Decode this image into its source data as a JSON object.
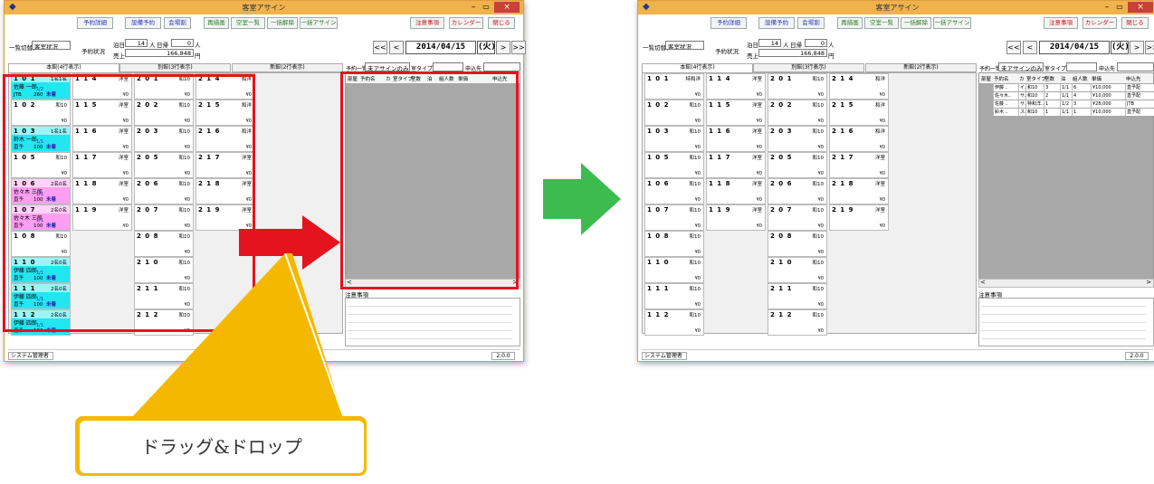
{
  "window": {
    "title": "客室アサイン",
    "close_label": "×"
  },
  "toolbar": {
    "left": [
      "予約詳細",
      "設備予約",
      "会場割"
    ],
    "middle": [
      "再描画",
      "空室一覧",
      "一括解除",
      "一括アサイン"
    ],
    "right": [
      "注意事項",
      "カレンダー",
      "閉じる"
    ]
  },
  "controls": {
    "view_label": "一覧切替：",
    "view_value": "客室状況",
    "status_label": "予約状況",
    "stay_label": "泊日",
    "stay_value": "14",
    "stay_unit": "人",
    "dayuse_label": "日帰",
    "dayuse_value": "0",
    "dayuse_unit": "人",
    "sales_label": "売上",
    "sales_value": "166,848",
    "sales_unit": "円",
    "nav_prev2": "<<",
    "nav_prev": "<",
    "date": "2014/04/15",
    "weekday": "(火)",
    "nav_next": ">",
    "nav_next2": ">>"
  },
  "tabs": [
    "本館(4行表示)",
    "別館(3行表示)",
    "新館(2行表示)"
  ],
  "reservations": {
    "label": "予約一覧：",
    "filter": "未アサインのみ",
    "room_type_label": "室タイプ",
    "applicant_label": "申込先",
    "columns": [
      "部屋",
      "予約名",
      "カ",
      "室タイプ",
      "室数",
      "泊",
      "組人数",
      "単価",
      "申込先"
    ],
    "rows": [
      [
        "",
        "伊藤 ..",
        "イ..",
        "和10",
        "3",
        "1/1",
        "6",
        "¥10,000",
        "直予配"
      ],
      [
        "",
        "佐々木..",
        "サ..",
        "和10",
        "2",
        "1/1",
        "4",
        "¥10,000",
        "直予配"
      ],
      [
        "",
        "佐藤 ..",
        "サ..",
        "特和洋..",
        "1",
        "1/2",
        "3",
        "¥28,000",
        "JTB"
      ],
      [
        "",
        "鈴木 ..",
        "ス..",
        "和10",
        "1",
        "1/1",
        "1",
        "¥10,000",
        "直予配"
      ]
    ]
  },
  "notes": {
    "label": "注意事項"
  },
  "status": {
    "user": "システム管理者",
    "version": "2.0.0"
  },
  "callout": {
    "text": "ドラッグ&ドロップ"
  },
  "colors": {
    "title_bar": "#f0b24a",
    "close": "#c9403a",
    "highlight": "#e5131e",
    "assigned_cyan": "#22e6f0",
    "assigned_pink": "#ff9ef2",
    "callout": "#f5b800",
    "green_arrow": "#3dbb4f"
  },
  "rooms_left": [
    {
      "no": "101",
      "type": "1名1名",
      "price": "¥0",
      "guest": "佐藤 一郎",
      "date": "1/2",
      "agent": "JTB",
      "pax": "260",
      "state": "未着",
      "color": "cyan"
    },
    {
      "no": "102",
      "type": "和10",
      "price": "¥0"
    },
    {
      "no": "103",
      "type": "1名1名",
      "price": "¥0",
      "guest": "鈴木 一郎",
      "date": "1/1",
      "agent": "直予",
      "pax": "100",
      "state": "未着",
      "color": "cyan"
    },
    {
      "no": "105",
      "type": "和10",
      "price": "¥0"
    },
    {
      "no": "106",
      "type": "2名0名",
      "price": "¥0",
      "guest": "佐々木 三郎",
      "date": "1/1",
      "agent": "直予",
      "pax": "100",
      "state": "未着",
      "color": "pink"
    },
    {
      "no": "107",
      "type": "2名0名",
      "price": "¥0",
      "guest": "佐々木 三郎",
      "date": "1/1",
      "agent": "直予",
      "pax": "100",
      "state": "未着",
      "color": "pink"
    },
    {
      "no": "108",
      "type": "和10",
      "price": "¥0"
    },
    {
      "no": "110",
      "type": "2名0名",
      "price": "¥0",
      "guest": "伊藤 四郎",
      "date": "1/1",
      "agent": "直予",
      "pax": "100",
      "state": "未着",
      "color": "cyan"
    },
    {
      "no": "111",
      "type": "2名0名",
      "price": "¥0",
      "guest": "伊藤 四郎",
      "date": "1/1",
      "agent": "直予",
      "pax": "100",
      "state": "未着",
      "color": "cyan"
    },
    {
      "no": "112",
      "type": "2名0名",
      "price": "¥0",
      "guest": "伊藤 四郎",
      "date": "1/1",
      "agent": "直予",
      "pax": "100",
      "state": "未着",
      "color": "cyan"
    }
  ],
  "rooms_col2": [
    {
      "no": "114",
      "type": "洋室",
      "price": "¥0"
    },
    {
      "no": "115",
      "type": "洋室",
      "price": "¥0"
    },
    {
      "no": "116",
      "type": "洋室",
      "price": "¥0"
    },
    {
      "no": "117",
      "type": "洋室",
      "price": "¥0"
    },
    {
      "no": "118",
      "type": "洋室",
      "price": "¥0"
    },
    {
      "no": "119",
      "type": "洋室",
      "price": "¥0"
    }
  ],
  "rooms_col3": [
    {
      "no": "201",
      "type": "和10",
      "price": "¥0"
    },
    {
      "no": "202",
      "type": "和10",
      "price": "¥0"
    },
    {
      "no": "203",
      "type": "和10",
      "price": "¥0"
    },
    {
      "no": "205",
      "type": "和10",
      "price": "¥0"
    },
    {
      "no": "206",
      "type": "和10",
      "price": "¥0"
    },
    {
      "no": "207",
      "type": "和10",
      "price": "¥0"
    },
    {
      "no": "208",
      "type": "和10",
      "price": "¥0"
    },
    {
      "no": "210",
      "type": "和10",
      "price": "¥0"
    },
    {
      "no": "211",
      "type": "和10",
      "price": "¥0"
    },
    {
      "no": "212",
      "type": "和10",
      "price": "¥0"
    }
  ],
  "rooms_col4": [
    {
      "no": "214",
      "type": "和洋",
      "price": "¥0"
    },
    {
      "no": "215",
      "type": "和洋",
      "price": "¥0"
    },
    {
      "no": "216",
      "type": "和洋",
      "price": "¥0"
    },
    {
      "no": "217",
      "type": "洋室",
      "price": "¥0"
    },
    {
      "no": "218",
      "type": "洋室",
      "price": "¥0"
    },
    {
      "no": "219",
      "type": "洋室",
      "price": "¥0"
    }
  ],
  "rooms_left_after": [
    {
      "no": "101",
      "type": "特和洋",
      "price": "¥0"
    },
    {
      "no": "102",
      "type": "和10",
      "price": "¥0"
    },
    {
      "no": "103",
      "type": "和10",
      "price": "¥0"
    },
    {
      "no": "105",
      "type": "和10",
      "price": "¥0"
    },
    {
      "no": "106",
      "type": "和10",
      "price": "¥0"
    },
    {
      "no": "107",
      "type": "和10",
      "price": "¥0"
    },
    {
      "no": "108",
      "type": "和10",
      "price": "¥0"
    },
    {
      "no": "110",
      "type": "和10",
      "price": "¥0"
    },
    {
      "no": "111",
      "type": "和10",
      "price": "¥0"
    },
    {
      "no": "112",
      "type": "和10",
      "price": "¥0"
    }
  ]
}
